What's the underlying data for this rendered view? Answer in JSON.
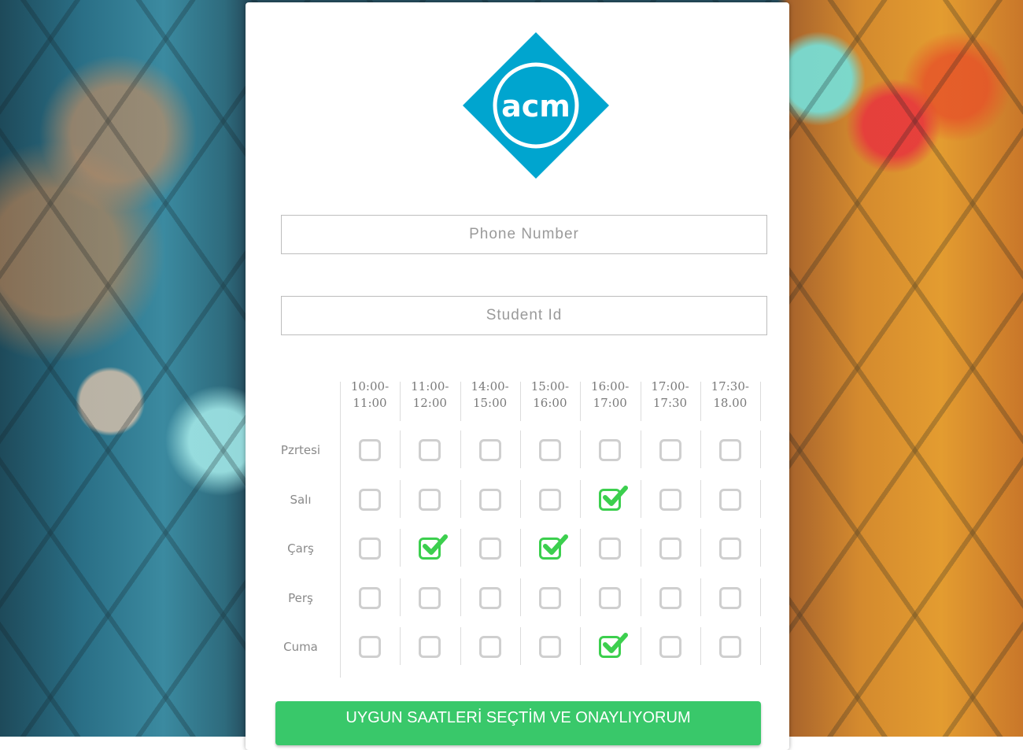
{
  "logo": {
    "text": "acm",
    "color": "#00a5cf"
  },
  "form": {
    "phone_placeholder": "Phone Number",
    "student_placeholder": "Student Id",
    "submit_label": "UYGUN SAATLERİ SEÇTİM VE ONAYLIYORUM"
  },
  "schedule": {
    "time_slots": [
      [
        "10:00-",
        "11:00"
      ],
      [
        "11:00-",
        "12:00"
      ],
      [
        "14:00-",
        "15:00"
      ],
      [
        "15:00-",
        "16:00"
      ],
      [
        "16:00-",
        "17:00"
      ],
      [
        "17:00-",
        "17:30"
      ],
      [
        "17:30-",
        "18.00"
      ]
    ],
    "days": [
      "Pzrtesi",
      "Salı",
      "Çarş",
      "Perş",
      "Cuma"
    ],
    "checked": [
      [
        false,
        false,
        false,
        false,
        false,
        false,
        false
      ],
      [
        false,
        false,
        false,
        false,
        true,
        false,
        false
      ],
      [
        false,
        true,
        false,
        true,
        false,
        false,
        false
      ],
      [
        false,
        false,
        false,
        false,
        false,
        false,
        false
      ],
      [
        false,
        false,
        false,
        false,
        true,
        false,
        false
      ]
    ]
  },
  "colors": {
    "checked": "#3ccf4e",
    "unchecked_border": "#cfcfcf",
    "submit_bg": "#39c86a"
  },
  "icons": {
    "check": "check-icon",
    "background": "chain-link-fence-bokeh"
  }
}
